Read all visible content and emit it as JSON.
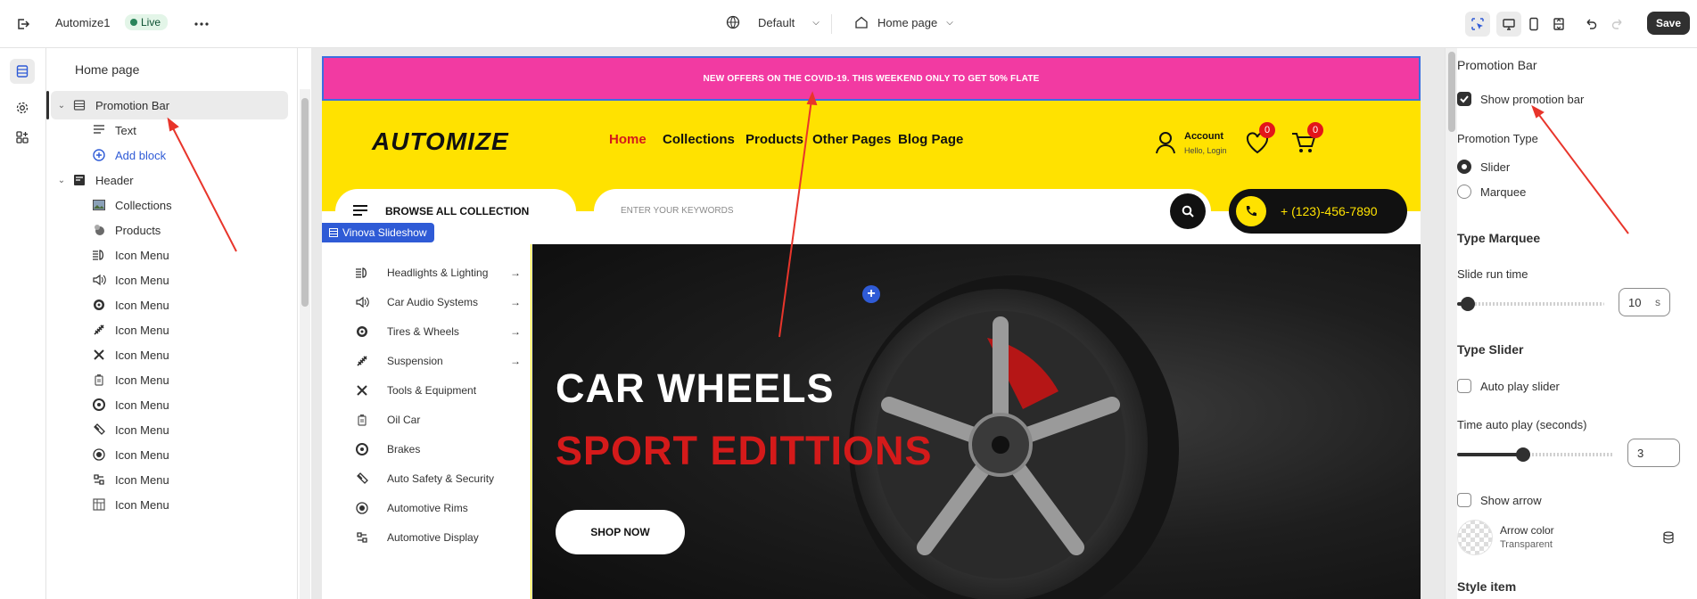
{
  "topbar": {
    "app_name": "Automize1",
    "live_label": "Live",
    "theme_selector": "Default",
    "page_selector": "Home page",
    "save_label": "Save"
  },
  "tree": {
    "title": "Home page",
    "items": [
      {
        "label": "Promotion Bar",
        "icon": "section-icon",
        "level": 0,
        "selected": true,
        "chevron": true
      },
      {
        "label": "Text",
        "icon": "text-lines-icon",
        "level": 1
      },
      {
        "label": "Add block",
        "icon": "plus-circle-icon",
        "level": 1,
        "add": true
      },
      {
        "label": "Header",
        "icon": "header-icon",
        "level": 0,
        "chevron": true
      },
      {
        "label": "Collections",
        "icon": "image-icon",
        "level": 1
      },
      {
        "label": "Products",
        "icon": "product-icon",
        "level": 1
      },
      {
        "label": "Icon Menu",
        "icon": "headlight-icon",
        "level": 1
      },
      {
        "label": "Icon Menu",
        "icon": "speaker-icon",
        "level": 1
      },
      {
        "label": "Icon Menu",
        "icon": "tire-icon",
        "level": 1
      },
      {
        "label": "Icon Menu",
        "icon": "spring-icon",
        "level": 1
      },
      {
        "label": "Icon Menu",
        "icon": "tools-icon",
        "level": 1
      },
      {
        "label": "Icon Menu",
        "icon": "oil-icon",
        "level": 1
      },
      {
        "label": "Icon Menu",
        "icon": "brake-icon",
        "level": 1
      },
      {
        "label": "Icon Menu",
        "icon": "safety-icon",
        "level": 1
      },
      {
        "label": "Icon Menu",
        "icon": "rim-icon",
        "level": 1
      },
      {
        "label": "Icon Menu",
        "icon": "display-icon",
        "level": 1
      },
      {
        "label": "Icon Menu",
        "icon": "grid-icon",
        "level": 1
      }
    ]
  },
  "preview": {
    "promo_text": "NEW OFFERS ON THE COVID-19. THIS WEEKEND ONLY TO GET 50% FLATE",
    "logo": "AUTOMIZE",
    "nav": [
      "Home",
      "Collections",
      "Products",
      "Other Pages",
      "Blog Page"
    ],
    "account_title": "Account",
    "account_sub": "Hello, Login",
    "wishlist_count": "0",
    "cart_count": "0",
    "browse_label": "BROWSE ALL COLLECTION",
    "search_placeholder": "ENTER YOUR KEYWORDS",
    "phone": "+ (123)-456-7890",
    "section_tag": "Vinova Slideshow",
    "menu": [
      {
        "label": "Headlights & Lighting",
        "arrow": true
      },
      {
        "label": "Car Audio Systems",
        "arrow": true
      },
      {
        "label": "Tires & Wheels",
        "arrow": true
      },
      {
        "label": "Suspension",
        "arrow": true
      },
      {
        "label": "Tools & Equipment",
        "arrow": false
      },
      {
        "label": "Oil Car",
        "arrow": false
      },
      {
        "label": "Brakes",
        "arrow": false
      },
      {
        "label": "Auto Safety & Security",
        "arrow": false
      },
      {
        "label": "Automotive Rims",
        "arrow": false
      },
      {
        "label": "Automotive Display",
        "arrow": false
      }
    ],
    "hero_title": "CAR WHEELS",
    "hero_subtitle": "SPORT EDITTIONS",
    "hero_button": "SHOP NOW",
    "accent_color": "#f23aa2",
    "header_color": "#ffe200"
  },
  "settings": {
    "section_title": "Promotion Bar",
    "show_promotion_bar": {
      "label": "Show promotion bar",
      "checked": true
    },
    "promotion_type": {
      "label": "Promotion Type",
      "options": [
        "Slider",
        "Marquee"
      ],
      "selected": "Slider"
    },
    "type_marquee": {
      "heading": "Type Marquee",
      "slide_run_time_label": "Slide run time",
      "slide_run_time_value": "10",
      "slide_run_time_unit": "s",
      "slide_run_time_fraction": 0.05
    },
    "type_slider": {
      "heading": "Type Slider",
      "auto_play_label": "Auto play slider",
      "auto_play_checked": false,
      "time_label": "Time auto play (seconds)",
      "time_value": "3",
      "time_fraction": 0.4
    },
    "show_arrow": {
      "label": "Show arrow",
      "checked": false
    },
    "arrow_color": {
      "label": "Arrow color",
      "value": "Transparent"
    },
    "style_item_heading": "Style item"
  }
}
